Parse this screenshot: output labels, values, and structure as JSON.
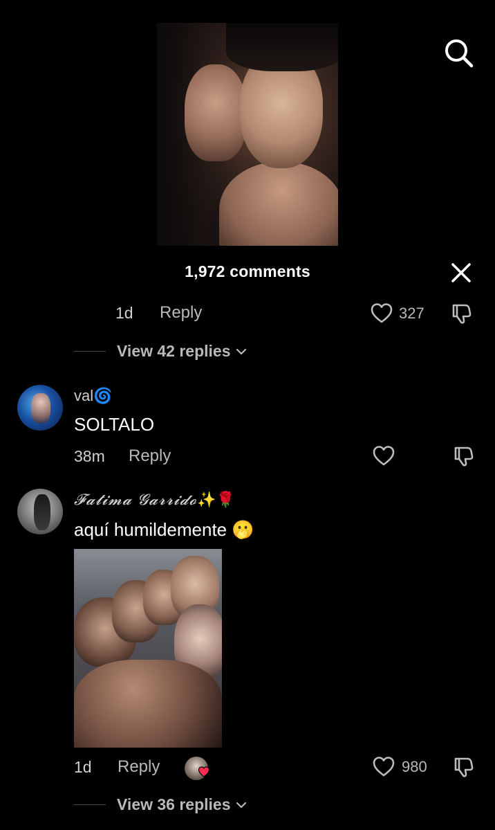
{
  "header": {
    "comments_count_label": "1,972 comments"
  },
  "first_comment_tail": {
    "time": "1d",
    "reply_label": "Reply",
    "likes": "327",
    "view_replies": "View 42 replies"
  },
  "comments": [
    {
      "username": "val",
      "username_emoji": "🌀",
      "text": "SOLTALO",
      "time": "38m",
      "reply_label": "Reply",
      "likes": ""
    },
    {
      "username": "𝓕𝓪𝓽𝓲𝓶𝓪 𝓖𝓪𝓻𝓻𝓲𝓭𝓸",
      "username_emoji": "✨🌹",
      "text": "aquí humildemente 🫢",
      "time": "1d",
      "reply_label": "Reply",
      "likes": "980",
      "view_replies": "View 36 replies"
    }
  ],
  "colors": {
    "background": "#000000",
    "text_primary": "#ffffff",
    "text_secondary": "#b9b9b9",
    "liked_by_creator_heart": "#fe2c55"
  },
  "icons": [
    "search-icon",
    "close-icon",
    "heart-icon",
    "dislike-icon",
    "chevron-down-icon"
  ]
}
